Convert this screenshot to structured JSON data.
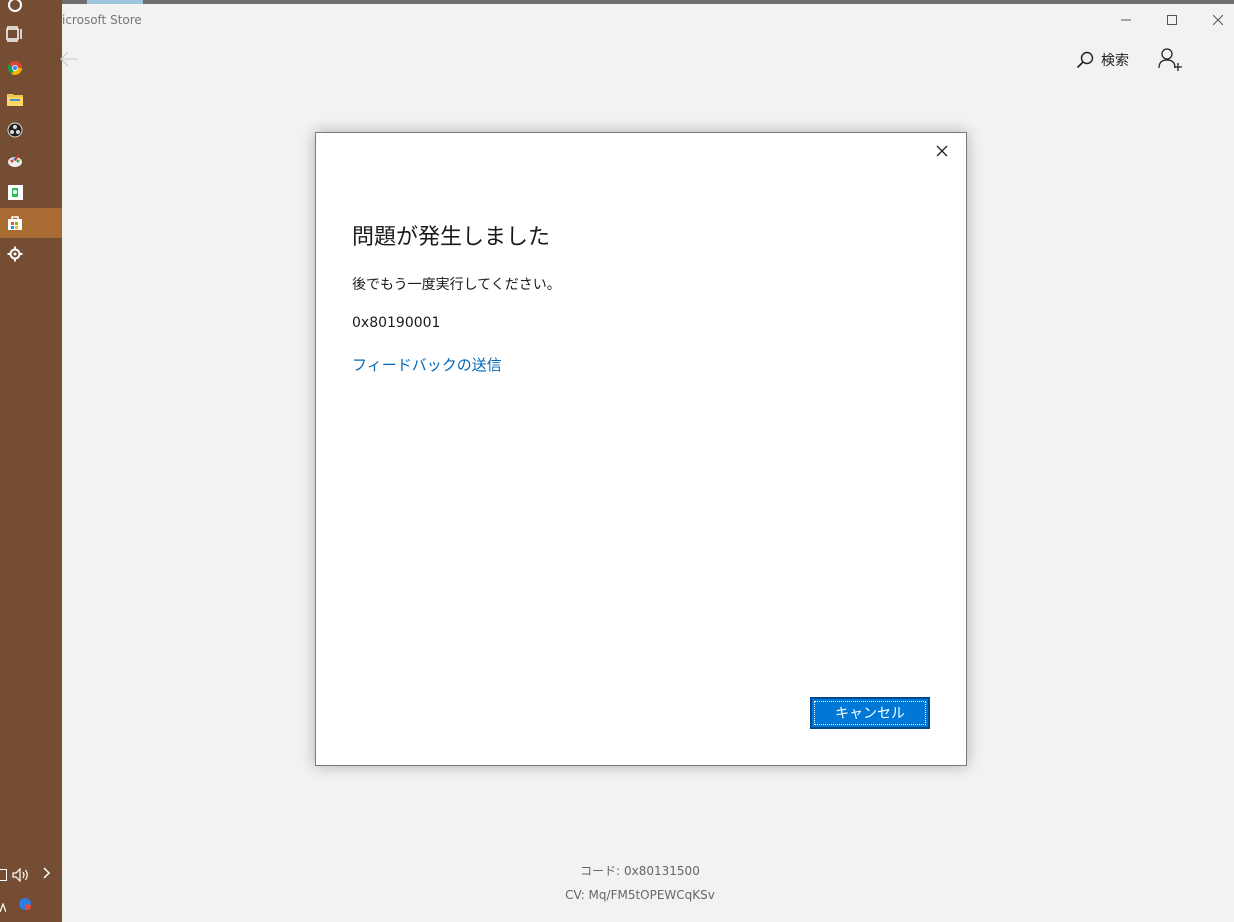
{
  "window": {
    "title": "icrosoft Store"
  },
  "toolbar": {
    "search_label": "検索"
  },
  "dialog": {
    "title": "問題が発生しました",
    "message": "後でもう一度実行してください。",
    "error_code": "0x80190001",
    "feedback_link": "フィードバックの送信",
    "cancel_label": "キャンセル"
  },
  "footer": {
    "code": "コード: 0x80131500",
    "cv": "CV: Mq/FM5tOPEWCqKSv"
  },
  "taskbar": {
    "icons": [
      "cortana-icon",
      "task-view-icon",
      "chrome-icon",
      "file-explorer-icon",
      "obs-icon",
      "paint-icon",
      "evernote-icon",
      "store-icon",
      "settings-icon"
    ],
    "active": "store-icon"
  },
  "colors": {
    "taskbar_bg": "#744d33",
    "taskbar_active": "#a86c33",
    "accent": "#0078d7",
    "link": "#0067b8"
  }
}
